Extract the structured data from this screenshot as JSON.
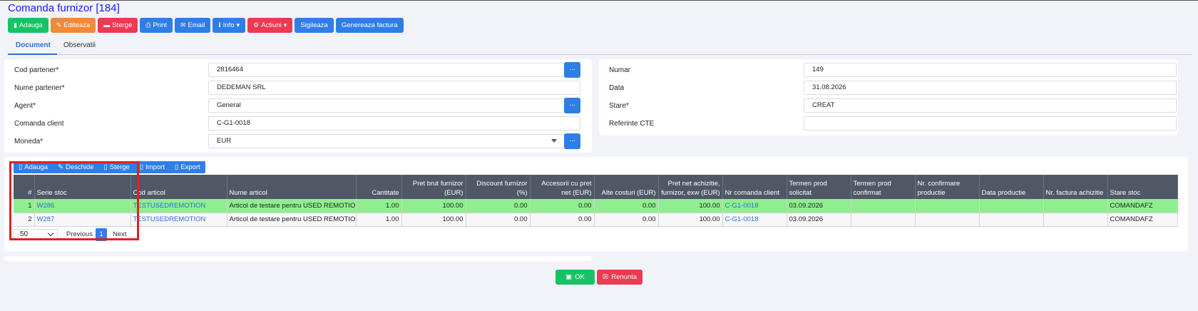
{
  "page_title": "Comanda furnizor [184]",
  "toolbar": {
    "adauga": "Adauga",
    "editeaza": "Editeaza",
    "sterge": "Sterge",
    "print": "Print",
    "email": "Email",
    "info": "Info",
    "actiuni": "Actiuni",
    "sigileaza": "Sigileaza",
    "genereaza_factura": "Genereaza factura"
  },
  "tabs": [
    "Document",
    "Observatii"
  ],
  "left_form": {
    "cod_partener": {
      "label": "Cod partener*",
      "value": "2816464",
      "button": "..."
    },
    "nume_partener": {
      "label": "Nume partener*",
      "value": "DEDEMAN SRL"
    },
    "agent": {
      "label": "Agent*",
      "value": "General",
      "button": "..."
    },
    "comanda_client": {
      "label": "Comanda client",
      "value": "C-G1-0018"
    },
    "moneda": {
      "label": "Moneda*",
      "value": "EUR",
      "button": "..."
    }
  },
  "right_form": {
    "numar": {
      "label": "Numar",
      "value": "149"
    },
    "data": {
      "label": "Data",
      "value": "31.08.2026"
    },
    "stare": {
      "label": "Stare*",
      "value": "CREAT"
    },
    "referinte": {
      "label": "Referinte CTE",
      "value": ""
    }
  },
  "grid_toolbar": {
    "adauga": "Adauga",
    "deschide": "Deschide",
    "sterge": "Sterge",
    "import": "Import",
    "export": "Export"
  },
  "table": {
    "headers": [
      "#",
      "Serie stoc",
      "Cod articol",
      "Nume articol",
      "Cantitate",
      "Pret brut furnizor (EUR)",
      "Discount furnizor (%)",
      "Accesorii cu pret net (EUR)",
      "Alte costuri (EUR)",
      "Pret net achizitie, furnizor, exw (EUR)",
      "Nr comanda client",
      "Termen prod solicitat",
      "Termen prod confirmat",
      "Nr. confirmare productie",
      "Data productie",
      "Nr. factura achizitie",
      "Stare stoc"
    ],
    "rows": [
      [
        "1",
        "W286",
        "TESTUSEDREMOTION",
        "Articol de testare pentru USED REMOTION",
        "1.00",
        "100.00",
        "0.00",
        "0.00",
        "0.00",
        "100.00",
        "C-G1-0018",
        "03.09.2026",
        "",
        "",
        "",
        "",
        "COMANDAFZ"
      ],
      [
        "2",
        "W287",
        "TESTUSEDREMOTION",
        "Articol de testare pentru USED REMOTION",
        "1.00",
        "100.00",
        "0.00",
        "0.00",
        "0.00",
        "100.00",
        "C-G1-0018",
        "03.09.2026",
        "",
        "",
        "",
        "",
        "COMANDAFZ"
      ]
    ]
  },
  "pager": {
    "page_size": "50",
    "previous": "Previous",
    "page": "1",
    "next": "Next"
  },
  "footer": {
    "ok": "OK",
    "renunta": "Renunta"
  },
  "colors": {
    "accent": "#2f7ee6",
    "success": "#17c264",
    "danger": "#eb3a52",
    "warning": "#f08a3a",
    "selected_row": "#90ee8e",
    "highlight_box": "#e0201f"
  }
}
